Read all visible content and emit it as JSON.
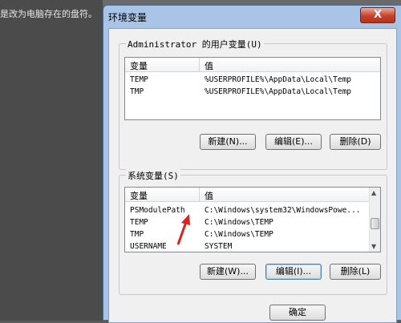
{
  "backdrop_text": "是改为电脑存在的盘符。",
  "window": {
    "title": "环境变量",
    "close_label": "X"
  },
  "user_vars": {
    "label": "Administrator 的用户变量(U)",
    "columns": [
      "变量",
      "值"
    ],
    "rows": [
      {
        "name": "TEMP",
        "value": "%USERPROFILE%\\AppData\\Local\\Temp"
      },
      {
        "name": "TMP",
        "value": "%USERPROFILE%\\AppData\\Local\\Temp"
      }
    ],
    "buttons": {
      "new": "新建(N)...",
      "edit": "编辑(E)...",
      "delete": "删除(D)"
    }
  },
  "system_vars": {
    "label": "系统变量(S)",
    "columns": [
      "变量",
      "值"
    ],
    "rows": [
      {
        "name": "PSModulePath",
        "value": "C:\\Windows\\system32\\WindowsPowe..."
      },
      {
        "name": "TEMP",
        "value": "C:\\Windows\\TEMP"
      },
      {
        "name": "TMP",
        "value": "C:\\Windows\\TEMP"
      },
      {
        "name": "USERNAME",
        "value": "SYSTEM"
      }
    ],
    "buttons": {
      "new": "新建(W)...",
      "edit": "编辑(I)...",
      "delete": "删除(L)"
    }
  },
  "ok_label": "确定"
}
